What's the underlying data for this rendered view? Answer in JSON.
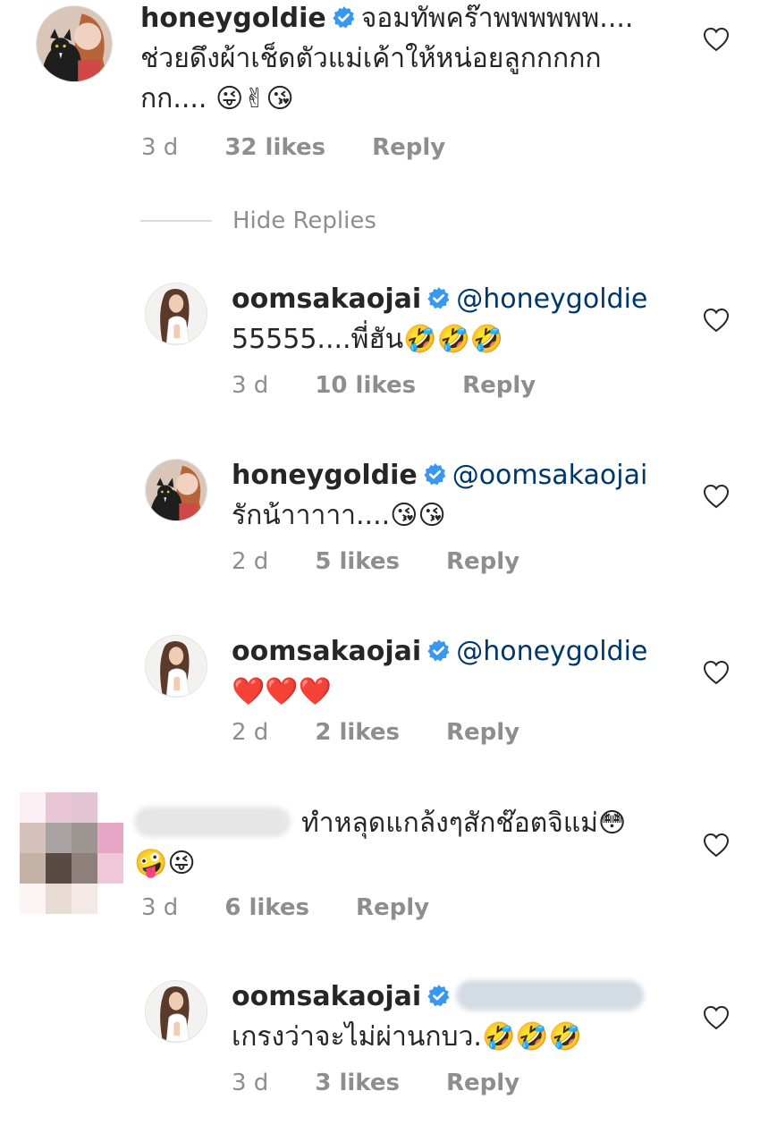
{
  "comments": [
    {
      "username": "honeygoldie",
      "text_line1": "จอมทัพคร๊าพพพพพพ....",
      "text_line2": "ช่วยดึงผ้าเช็ดตัวแม่เค้าให้หน่อยลูกกกกก",
      "text_line3": "กก.... 😜✌😘",
      "time": "3 d",
      "likes": "32 likes",
      "reply": "Reply"
    },
    {
      "username": "oomsakaojai",
      "mention": "@honeygoldie",
      "text": "55555....พี่ฮัน🤣🤣🤣",
      "time": "3 d",
      "likes": "10 likes",
      "reply": "Reply"
    },
    {
      "username": "honeygoldie",
      "mention": "@oomsakaojai",
      "text": "รักน้าาาาา....😘😘",
      "time": "2 d",
      "likes": "5 likes",
      "reply": "Reply"
    },
    {
      "username": "oomsakaojai",
      "mention": "@honeygoldie",
      "text": "❤️❤️❤️",
      "time": "2 d",
      "likes": "2 likes",
      "reply": "Reply"
    },
    {
      "text_line1": "ทำหลุดแกล้งๆสักช๊อตจิแม่😳",
      "text_line2": "🤪😜",
      "time": "3 d",
      "likes": "6 likes",
      "reply": "Reply"
    },
    {
      "username": "oomsakaojai",
      "text": "เกรงว่าจะไม่ผ่านกบว.🤣🤣🤣",
      "time": "3 d",
      "likes": "3 likes",
      "reply": "Reply"
    }
  ],
  "hide_replies": "Hide Replies",
  "colors": {
    "text": "#262626",
    "secondary": "#8e8e8e",
    "mention": "#00376b",
    "verified": "#3897f0"
  }
}
